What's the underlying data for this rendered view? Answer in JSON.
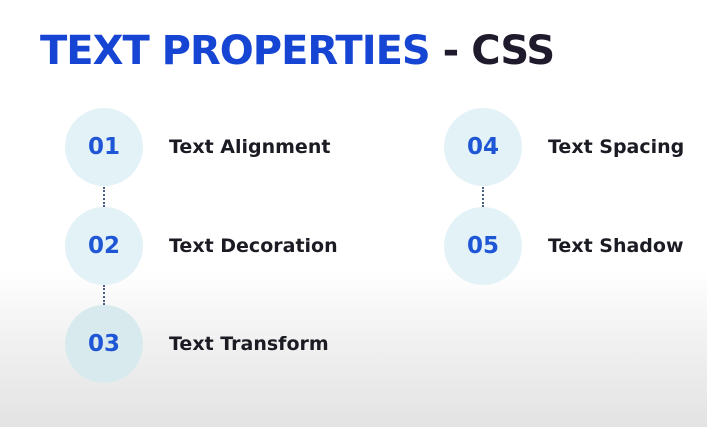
{
  "title": {
    "main": "TEXT PROPERTIES",
    "separator": "-",
    "accent": "CSS"
  },
  "items": [
    {
      "number": "01",
      "label": "Text Alignment"
    },
    {
      "number": "02",
      "label": "Text Decoration"
    },
    {
      "number": "03",
      "label": "Text Transform"
    },
    {
      "number": "04",
      "label": "Text Spacing"
    },
    {
      "number": "05",
      "label": "Text Shadow"
    }
  ],
  "colors": {
    "title_blue": "#1745d3",
    "title_dark": "#1f1b2d",
    "number_blue": "#1f56d6",
    "circle_fill": "#e3f2f7",
    "label_text": "#1b1b24"
  }
}
